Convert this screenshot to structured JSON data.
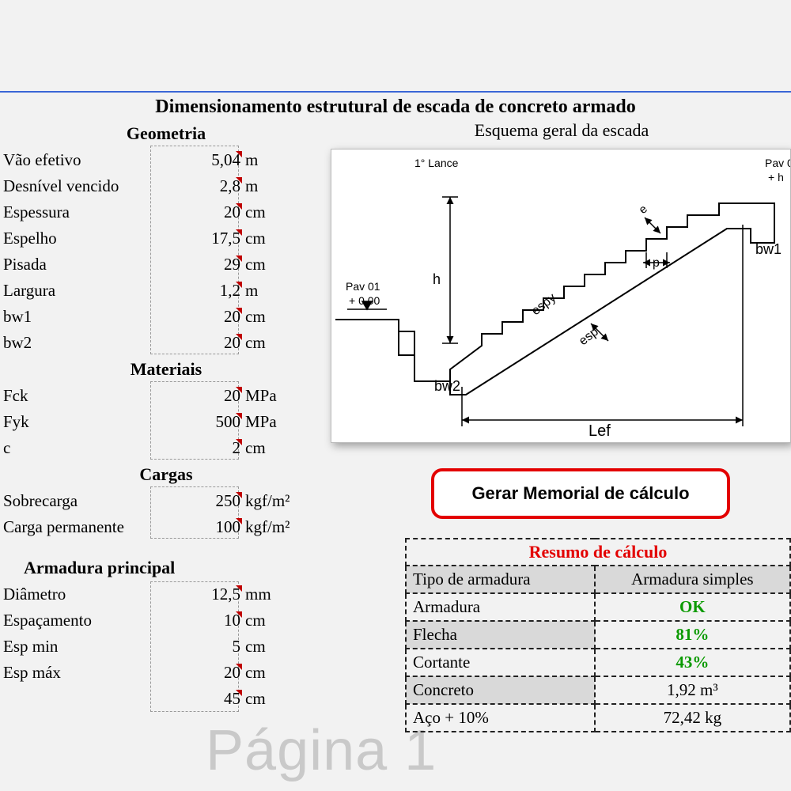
{
  "title": "Dimensionamento estrutural de escada de concreto armado",
  "watermark": "Página 1",
  "left": {
    "geometria": {
      "head": "Geometria",
      "rows": [
        {
          "label": "Vão efetivo",
          "value": "5,04",
          "unit": "m"
        },
        {
          "label": "Desnível vencido",
          "value": "2,8",
          "unit": "m"
        },
        {
          "label": "Espessura",
          "value": "20",
          "unit": "cm"
        },
        {
          "label": "Espelho",
          "value": "17,5",
          "unit": "cm"
        },
        {
          "label": "Pisada",
          "value": "29",
          "unit": "cm"
        },
        {
          "label": "Largura",
          "value": "1,2",
          "unit": "m"
        },
        {
          "label": "bw1",
          "value": "20",
          "unit": "cm"
        },
        {
          "label": "bw2",
          "value": "20",
          "unit": "cm"
        }
      ]
    },
    "materiais": {
      "head": "Materiais",
      "rows": [
        {
          "label": "Fck",
          "value": "20",
          "unit": "MPa"
        },
        {
          "label": "Fyk",
          "value": "500",
          "unit": "MPa"
        },
        {
          "label": "c",
          "value": "2",
          "unit": "cm"
        }
      ]
    },
    "cargas": {
      "head": "Cargas",
      "rows": [
        {
          "label": "Sobrecarga",
          "value": "250",
          "unit": "kgf/m²"
        },
        {
          "label": "Carga permanente",
          "value": "100",
          "unit": "kgf/m²"
        }
      ]
    },
    "armadura": {
      "head": "Armadura principal",
      "rows": [
        {
          "label": "Diâmetro",
          "value": "12,5",
          "unit": "mm"
        },
        {
          "label": "Espaçamento",
          "value": "10",
          "unit": "cm"
        },
        {
          "label": "Esp min",
          "value": "5",
          "unit": "cm"
        },
        {
          "label": "Esp máx",
          "value": "20",
          "unit": "cm"
        },
        {
          "label": "",
          "value": "45",
          "unit": "cm"
        }
      ]
    }
  },
  "diagram": {
    "title": "Esquema geral da escada",
    "labels": {
      "lance": "1° Lance",
      "pav01": "Pav 01",
      "pav01_lvl": "+ 0.00",
      "pav0_right": "Pav 0",
      "pav0_right_h": "+ h",
      "bw1": "bw1",
      "bw2": "bw2",
      "h": "h",
      "e": "e",
      "p": "p",
      "esp": "esp",
      "espy": "espy",
      "lef": "Lef"
    }
  },
  "button": {
    "label": "Gerar Memorial de cálculo"
  },
  "results": {
    "title": "Resumo de cálculo",
    "cols": [
      "Tipo de armadura",
      "Armadura simples"
    ],
    "rows": [
      {
        "label": "Armadura",
        "value": "OK",
        "green": true
      },
      {
        "label": "Flecha",
        "value": "81%",
        "green": true
      },
      {
        "label": "Cortante",
        "value": "43%",
        "green": true
      },
      {
        "label": "Concreto",
        "value": "1,92 m³",
        "green": false
      },
      {
        "label": "Aço + 10%",
        "value": "72,42 kg",
        "green": false
      }
    ]
  }
}
